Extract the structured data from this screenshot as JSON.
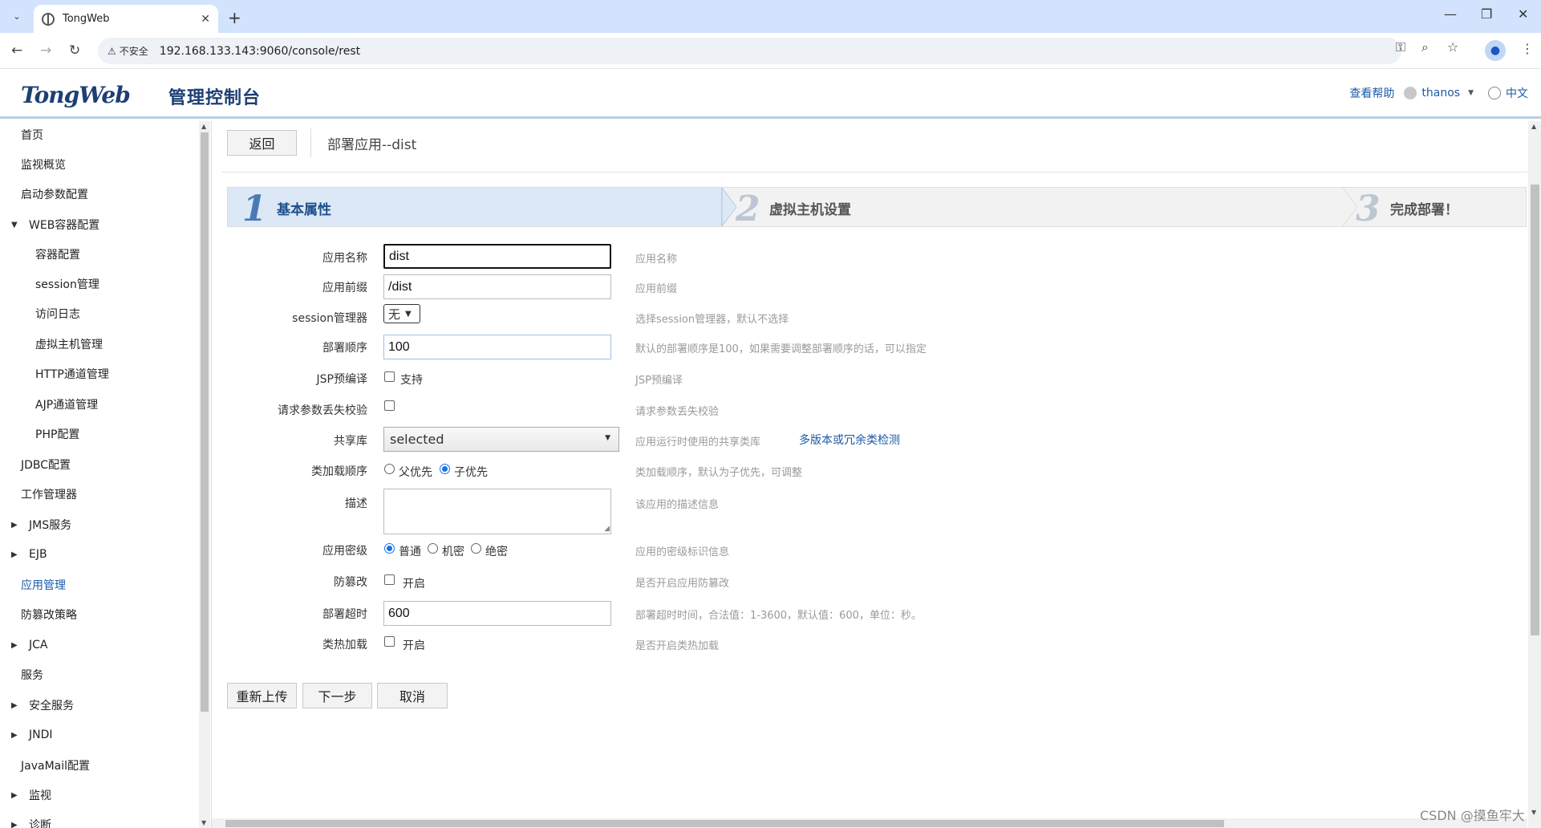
{
  "browser": {
    "tab_title": "TongWeb",
    "insecure_label": "不安全",
    "url": "192.168.133.143:9060/console/rest"
  },
  "header": {
    "logo_text": "TongWeb",
    "logo_sub": "管理控制台",
    "help_link": "查看帮助",
    "username": "thanos",
    "language": "中文"
  },
  "sidebar": {
    "items": [
      {
        "label": "首页"
      },
      {
        "label": "监视概览"
      },
      {
        "label": "启动参数配置"
      },
      {
        "label": "WEB容器配置"
      },
      {
        "label": "容器配置"
      },
      {
        "label": "session管理"
      },
      {
        "label": "访问日志"
      },
      {
        "label": "虚拟主机管理"
      },
      {
        "label": "HTTP通道管理"
      },
      {
        "label": "AJP通道管理"
      },
      {
        "label": "PHP配置"
      },
      {
        "label": "JDBC配置"
      },
      {
        "label": "工作管理器"
      },
      {
        "label": "JMS服务"
      },
      {
        "label": "EJB"
      },
      {
        "label": "应用管理"
      },
      {
        "label": "防篡改策略"
      },
      {
        "label": "JCA"
      },
      {
        "label": "服务"
      },
      {
        "label": "安全服务"
      },
      {
        "label": "JNDI"
      },
      {
        "label": "JavaMail配置"
      },
      {
        "label": "监视"
      },
      {
        "label": "诊断"
      }
    ]
  },
  "main": {
    "back_button": "返回",
    "page_title": "部署应用--dist",
    "steps": [
      {
        "num": "1",
        "label": "基本属性"
      },
      {
        "num": "2",
        "label": "虚拟主机设置"
      },
      {
        "num": "3",
        "label": "完成部署！"
      }
    ],
    "form": {
      "app_name": {
        "label": "应用名称",
        "value": "dist",
        "hint": "应用名称"
      },
      "app_prefix": {
        "label": "应用前缀",
        "value": "/dist",
        "hint": "应用前缀"
      },
      "session_manager": {
        "label": "session管理器",
        "value": "无",
        "hint": "选择session管理器，默认不选择"
      },
      "deploy_order": {
        "label": "部署顺序",
        "value": "100",
        "hint": "默认的部署顺序是100，如果需要调整部署顺序的话，可以指定"
      },
      "jsp_precompile": {
        "label": "JSP预编译",
        "option": "支持",
        "hint": "JSP预编译"
      },
      "param_loss_check": {
        "label": "请求参数丢失校验",
        "hint": "请求参数丢失校验"
      },
      "shared_lib": {
        "label": "共享库",
        "value": "selected",
        "hint": "应用运行时使用的共享类库",
        "link": "多版本或冗余类检测"
      },
      "class_load_order": {
        "label": "类加载顺序",
        "opt_parent": "父优先",
        "opt_child": "子优先",
        "hint": "类加载顺序，默认为子优先，可调整"
      },
      "description": {
        "label": "描述",
        "hint": "该应用的描述信息"
      },
      "security_level": {
        "label": "应用密级",
        "opt_normal": "普通",
        "opt_secret": "机密",
        "opt_top": "绝密",
        "hint": "应用的密级标识信息"
      },
      "tamper_proof": {
        "label": "防篡改",
        "option": "开启",
        "hint": "是否开启应用防篡改"
      },
      "deploy_timeout": {
        "label": "部署超时",
        "value": "600",
        "hint": "部署超时时间，合法值：1-3600，默认值：600，单位：秒。"
      },
      "hot_reload": {
        "label": "类热加载",
        "option": "开启",
        "hint": "是否开启类热加载"
      }
    },
    "buttons": {
      "reupload": "重新上传",
      "next": "下一步",
      "cancel": "取消"
    }
  },
  "watermark": "CSDN @摸鱼牢大"
}
